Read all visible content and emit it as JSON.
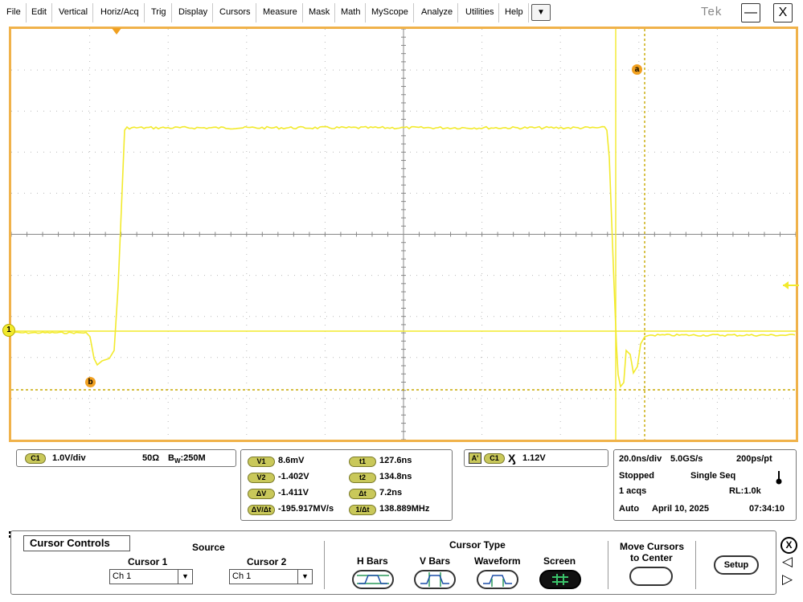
{
  "menu": {
    "items": [
      "File",
      "Edit",
      "Vertical",
      "Horiz/Acq",
      "Trig",
      "Display",
      "Cursors",
      "Measure",
      "Mask",
      "Math",
      "MyScope",
      "Analyze",
      "Utilities",
      "Help"
    ],
    "dropdown_icon": "chevron-down-icon",
    "brand": "Tek",
    "minimize_label": "—",
    "close_label": "X"
  },
  "display": {
    "trace_color": "#f2ea2c",
    "graticule_color": "#f0b24a",
    "channel_marker": "1",
    "cursor_a_label": "a",
    "cursor_b_label": "b"
  },
  "channel": {
    "badge": "C1",
    "scale": "1.0V/div",
    "impedance": "50Ω",
    "bw_prefix": "B",
    "bw_sub": "W",
    "bandwidth": ":250M"
  },
  "cursor_readout": {
    "v1_label": "V1",
    "v1": "8.6mV",
    "v2_label": "V2",
    "v2": "-1.402V",
    "dv_label": "ΔV",
    "dv": "-1.411V",
    "dvdt_label": "ΔV/Δt",
    "dvdt": "-195.917MV/s",
    "t1_label": "t1",
    "t1": "127.6ns",
    "t2_label": "t2",
    "t2": "134.8ns",
    "dt_label": "Δt",
    "dt": "7.2ns",
    "inv_dt_label": "1/Δt",
    "inv_dt": "138.889MHz"
  },
  "trigger": {
    "badge_a": "A'",
    "badge_c1": "C1",
    "symbol": "Ӽ",
    "level": "1.12V"
  },
  "acquisition": {
    "timebase": "20.0ns/div",
    "sample_rate": "5.0GS/s",
    "resolution": "200ps/pt",
    "state": "Stopped",
    "mode": "Single Seq",
    "acqs": "1 acqs",
    "record_length": "RL:1.0k",
    "trigger_mode": "Auto",
    "date": "April 10, 2025",
    "time": "07:34:10"
  },
  "cursor_controls": {
    "title": "Cursor Controls",
    "source_label": "Source",
    "cursor1_label": "Cursor 1",
    "cursor1_value": "Ch 1",
    "cursor2_label": "Cursor 2",
    "cursor2_value": "Ch 1",
    "cursor_type_label": "Cursor Type",
    "types": [
      "H Bars",
      "V Bars",
      "Waveform",
      "Screen"
    ],
    "selected_type": "Screen",
    "move_label_1": "Move Cursors",
    "move_label_2": "to Center",
    "setup_label": "Setup",
    "close_label": "X",
    "prev_label": "◁",
    "next_label": "▷"
  }
}
